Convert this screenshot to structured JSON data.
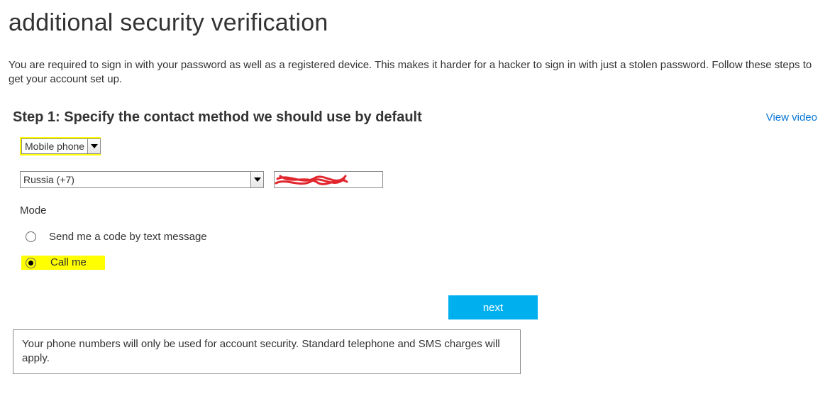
{
  "page": {
    "title": "additional security verification",
    "intro": "You are required to sign in with your password as well as a registered device. This makes it harder for a hacker to sign in with just a stolen password. Follow these steps to get your account set up."
  },
  "step": {
    "heading": "Step 1: Specify the contact method we should use by default",
    "view_video": "View video"
  },
  "contact_method": {
    "selected": "Mobile phone"
  },
  "country": {
    "selected": "Russia (+7)"
  },
  "phone": {
    "value_redacted": true
  },
  "mode": {
    "label": "Mode",
    "options": {
      "text": "Send me a code by text message",
      "call": "Call me"
    },
    "selected": "call"
  },
  "actions": {
    "next": "next"
  },
  "notice": "Your phone numbers will only be used for account security. Standard telephone and SMS charges will apply."
}
